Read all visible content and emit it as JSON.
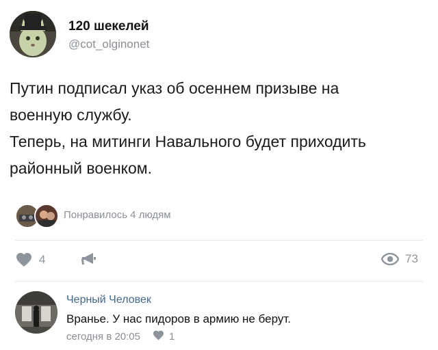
{
  "author": {
    "name": "120 шекелей",
    "handle": "@cot_olginonet"
  },
  "post": {
    "lines": [
      "Путин подписал указ об осеннем призыве на",
      "военную службу.",
      "Теперь, на митинги Навального будет приходить",
      "районный военком."
    ]
  },
  "likes_summary": "Понравилось 4 людям",
  "actions": {
    "like_count": "4",
    "views_count": "73",
    "like_icon": "heart-icon",
    "share_icon": "megaphone-icon",
    "views_icon": "eye-icon"
  },
  "comment": {
    "author": "Черный Человек",
    "text": "Вранье. У нас пидоров в армию не берут.",
    "time": "сегодня в 20:05",
    "like_count": "1"
  },
  "colors": {
    "link": "#41688f",
    "muted": "#8a8f96",
    "icon": "#8e949b",
    "divider": "#e4e6ea"
  }
}
